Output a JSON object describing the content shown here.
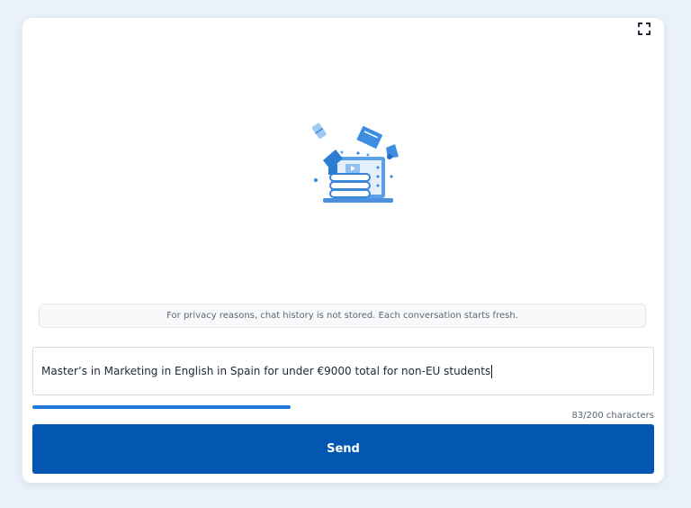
{
  "toolbar": {
    "expand_icon": "expand-icon"
  },
  "illustration": {
    "icon": "education-laptop-illustration"
  },
  "notice": {
    "text": "For privacy reasons, chat history is not stored. Each conversation starts fresh."
  },
  "chat_input": {
    "value": "Master’s in Marketing in English in Spain for under €9000 total for non-EU students"
  },
  "progress": {
    "fraction": 0.415
  },
  "char_count": {
    "text": "83/200 characters"
  },
  "send_button": {
    "label": "Send"
  },
  "colors": {
    "primary": "#0457b0",
    "accent": "#2179d6",
    "background": "#eaf1f9"
  }
}
